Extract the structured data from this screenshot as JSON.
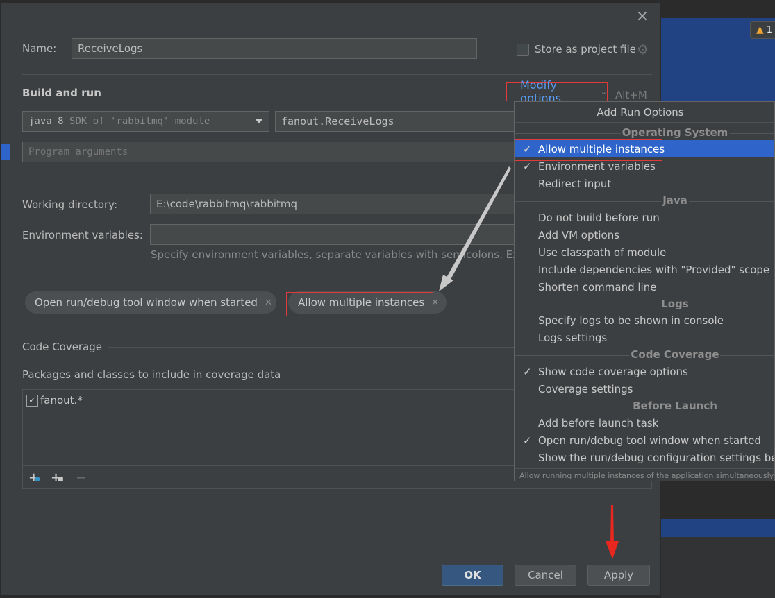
{
  "warning_badge": "1",
  "dialog": {
    "close_label": "×",
    "name_label": "Name:",
    "name_value": "ReceiveLogs",
    "store_label": "Store as project file",
    "build_run_label": "Build and run",
    "modify_options_label": "Modify options",
    "modify_shortcut": "Alt+M",
    "sdk_main": "java 8",
    "sdk_dim": "SDK of 'rabbitmq' module",
    "main_class": "fanout.ReceiveLogs",
    "program_args_placeholder": "Program arguments",
    "working_dir_label": "Working directory:",
    "working_dir_value": "E:\\code\\rabbitmq\\rabbitmq",
    "env_vars_label": "Environment variables:",
    "env_hint": "Specify environment variables, separate variables with semicolons. Example",
    "chips": [
      "Open run/debug tool window when started",
      "Allow multiple instances"
    ],
    "coverage_label": "Code Coverage",
    "packages_label": "Packages and classes to include in coverage data",
    "package_item": "fanout.*",
    "ok_label": "OK",
    "cancel_label": "Cancel",
    "apply_label": "Apply"
  },
  "popup": {
    "title": "Add Run Options",
    "groups": {
      "os": "Operating System",
      "java": "Java",
      "logs": "Logs",
      "coverage": "Code Coverage",
      "before_launch": "Before Launch"
    },
    "items": {
      "allow_multiple": "Allow multiple instances",
      "env_vars": "Environment variables",
      "redirect_input": "Redirect input",
      "no_build": "Do not build before run",
      "add_vm": "Add VM options",
      "classpath": "Use classpath of module",
      "include_deps": "Include dependencies with \"Provided\" scope",
      "shorten_cmd": "Shorten command line",
      "specify_logs": "Specify logs to be shown in console",
      "logs_settings": "Logs settings",
      "show_coverage": "Show code coverage options",
      "coverage_settings": "Coverage settings",
      "add_before_launch": "Add before launch task",
      "open_tool_window": "Open run/debug tool window when started",
      "show_settings": "Show the run/debug configuration settings before start"
    },
    "footer": "Allow running multiple instances of the application simultaneously"
  },
  "colors": {
    "selection": "#2f65ca",
    "annotation": "#e03a3a",
    "link": "#589df6"
  }
}
